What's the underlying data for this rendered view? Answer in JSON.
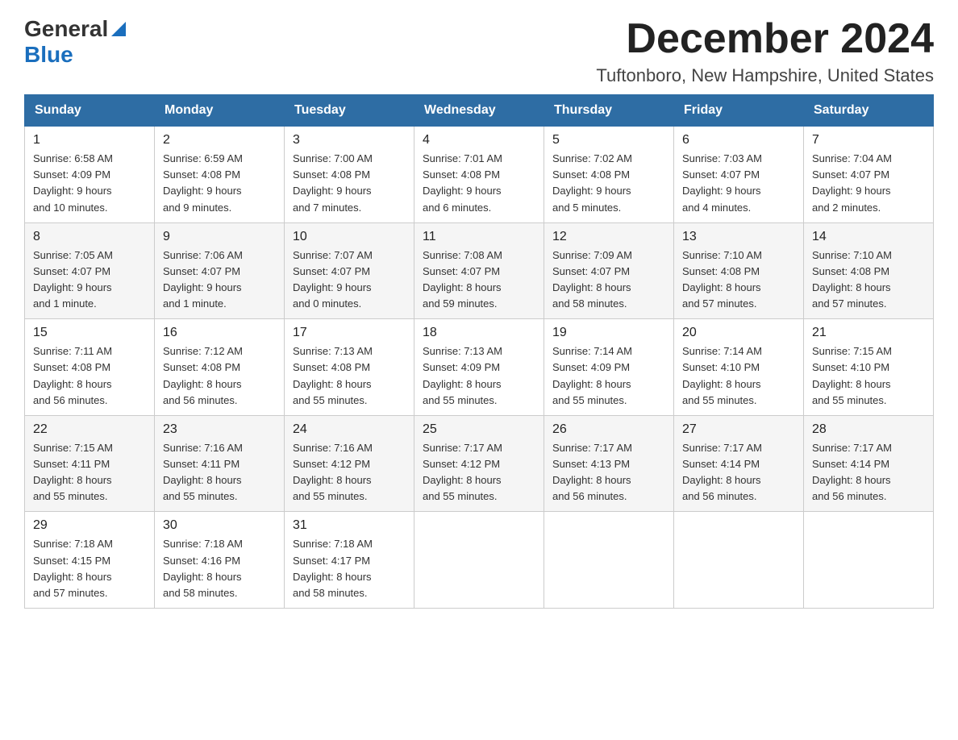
{
  "logo": {
    "general": "General",
    "blue": "Blue"
  },
  "title": {
    "month_year": "December 2024",
    "location": "Tuftonboro, New Hampshire, United States"
  },
  "days_of_week": [
    "Sunday",
    "Monday",
    "Tuesday",
    "Wednesday",
    "Thursday",
    "Friday",
    "Saturday"
  ],
  "weeks": [
    [
      {
        "day": "1",
        "sunrise": "6:58 AM",
        "sunset": "4:09 PM",
        "daylight": "9 hours and 10 minutes."
      },
      {
        "day": "2",
        "sunrise": "6:59 AM",
        "sunset": "4:08 PM",
        "daylight": "9 hours and 9 minutes."
      },
      {
        "day": "3",
        "sunrise": "7:00 AM",
        "sunset": "4:08 PM",
        "daylight": "9 hours and 7 minutes."
      },
      {
        "day": "4",
        "sunrise": "7:01 AM",
        "sunset": "4:08 PM",
        "daylight": "9 hours and 6 minutes."
      },
      {
        "day": "5",
        "sunrise": "7:02 AM",
        "sunset": "4:08 PM",
        "daylight": "9 hours and 5 minutes."
      },
      {
        "day": "6",
        "sunrise": "7:03 AM",
        "sunset": "4:07 PM",
        "daylight": "9 hours and 4 minutes."
      },
      {
        "day": "7",
        "sunrise": "7:04 AM",
        "sunset": "4:07 PM",
        "daylight": "9 hours and 2 minutes."
      }
    ],
    [
      {
        "day": "8",
        "sunrise": "7:05 AM",
        "sunset": "4:07 PM",
        "daylight": "9 hours and 1 minute."
      },
      {
        "day": "9",
        "sunrise": "7:06 AM",
        "sunset": "4:07 PM",
        "daylight": "9 hours and 1 minute."
      },
      {
        "day": "10",
        "sunrise": "7:07 AM",
        "sunset": "4:07 PM",
        "daylight": "9 hours and 0 minutes."
      },
      {
        "day": "11",
        "sunrise": "7:08 AM",
        "sunset": "4:07 PM",
        "daylight": "8 hours and 59 minutes."
      },
      {
        "day": "12",
        "sunrise": "7:09 AM",
        "sunset": "4:07 PM",
        "daylight": "8 hours and 58 minutes."
      },
      {
        "day": "13",
        "sunrise": "7:10 AM",
        "sunset": "4:08 PM",
        "daylight": "8 hours and 57 minutes."
      },
      {
        "day": "14",
        "sunrise": "7:10 AM",
        "sunset": "4:08 PM",
        "daylight": "8 hours and 57 minutes."
      }
    ],
    [
      {
        "day": "15",
        "sunrise": "7:11 AM",
        "sunset": "4:08 PM",
        "daylight": "8 hours and 56 minutes."
      },
      {
        "day": "16",
        "sunrise": "7:12 AM",
        "sunset": "4:08 PM",
        "daylight": "8 hours and 56 minutes."
      },
      {
        "day": "17",
        "sunrise": "7:13 AM",
        "sunset": "4:08 PM",
        "daylight": "8 hours and 55 minutes."
      },
      {
        "day": "18",
        "sunrise": "7:13 AM",
        "sunset": "4:09 PM",
        "daylight": "8 hours and 55 minutes."
      },
      {
        "day": "19",
        "sunrise": "7:14 AM",
        "sunset": "4:09 PM",
        "daylight": "8 hours and 55 minutes."
      },
      {
        "day": "20",
        "sunrise": "7:14 AM",
        "sunset": "4:10 PM",
        "daylight": "8 hours and 55 minutes."
      },
      {
        "day": "21",
        "sunrise": "7:15 AM",
        "sunset": "4:10 PM",
        "daylight": "8 hours and 55 minutes."
      }
    ],
    [
      {
        "day": "22",
        "sunrise": "7:15 AM",
        "sunset": "4:11 PM",
        "daylight": "8 hours and 55 minutes."
      },
      {
        "day": "23",
        "sunrise": "7:16 AM",
        "sunset": "4:11 PM",
        "daylight": "8 hours and 55 minutes."
      },
      {
        "day": "24",
        "sunrise": "7:16 AM",
        "sunset": "4:12 PM",
        "daylight": "8 hours and 55 minutes."
      },
      {
        "day": "25",
        "sunrise": "7:17 AM",
        "sunset": "4:12 PM",
        "daylight": "8 hours and 55 minutes."
      },
      {
        "day": "26",
        "sunrise": "7:17 AM",
        "sunset": "4:13 PM",
        "daylight": "8 hours and 56 minutes."
      },
      {
        "day": "27",
        "sunrise": "7:17 AM",
        "sunset": "4:14 PM",
        "daylight": "8 hours and 56 minutes."
      },
      {
        "day": "28",
        "sunrise": "7:17 AM",
        "sunset": "4:14 PM",
        "daylight": "8 hours and 56 minutes."
      }
    ],
    [
      {
        "day": "29",
        "sunrise": "7:18 AM",
        "sunset": "4:15 PM",
        "daylight": "8 hours and 57 minutes."
      },
      {
        "day": "30",
        "sunrise": "7:18 AM",
        "sunset": "4:16 PM",
        "daylight": "8 hours and 58 minutes."
      },
      {
        "day": "31",
        "sunrise": "7:18 AM",
        "sunset": "4:17 PM",
        "daylight": "8 hours and 58 minutes."
      },
      null,
      null,
      null,
      null
    ]
  ],
  "labels": {
    "sunrise": "Sunrise:",
    "sunset": "Sunset:",
    "daylight": "Daylight:"
  }
}
